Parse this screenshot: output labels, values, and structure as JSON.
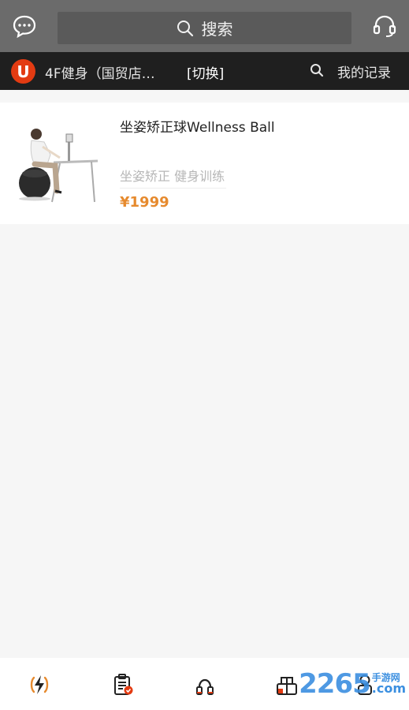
{
  "header": {
    "search_label": "搜索",
    "icons": {
      "left": "chat-bubble-icon",
      "right": "headset-icon",
      "search": "search-icon"
    }
  },
  "store_bar": {
    "logo_letter": "U",
    "store_name": "4F健身（国贸店…",
    "switch_label": "[切换]",
    "records_label": "我的记录",
    "colors": {
      "background": "#1f1f1f",
      "logo": "#e33b12"
    }
  },
  "product": {
    "title": "坐姿矫正球Wellness Ball",
    "tags": "坐姿矫正  健身训练",
    "price": "¥1999",
    "price_color": "#e68a2e"
  },
  "tabbar": {
    "tabs": [
      {
        "icon": "lightning-icon"
      },
      {
        "icon": "clipboard-check-icon"
      },
      {
        "icon": "jump-rope-icon"
      },
      {
        "icon": "store-icon"
      },
      {
        "icon": "person-icon"
      }
    ]
  },
  "watermark": {
    "number": "2265",
    "cn": "手游网",
    "com": ".com"
  }
}
